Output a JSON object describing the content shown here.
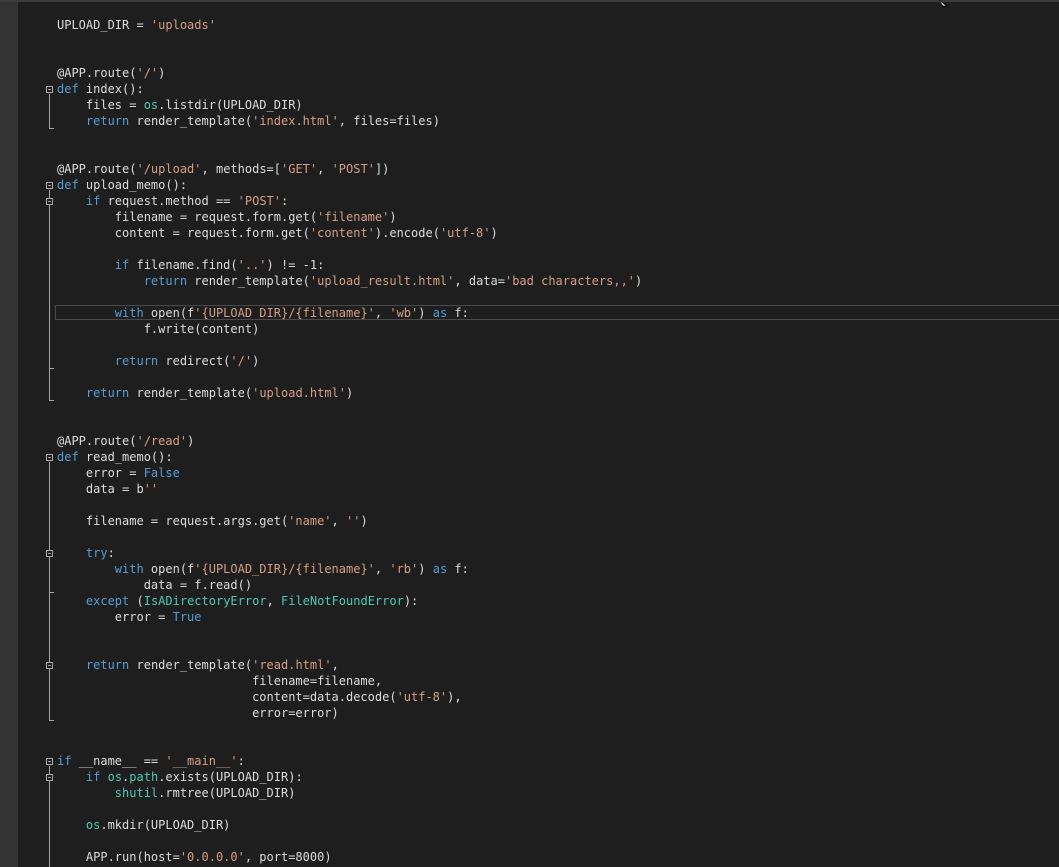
{
  "editor": {
    "lines": [
      [
        [
          "d",
          "UPLOAD_DIR = "
        ],
        [
          "s",
          "'uploads'"
        ]
      ],
      [],
      [],
      [
        [
          "d",
          "@APP.route("
        ],
        [
          "s",
          "'/'"
        ],
        [
          "d",
          ")"
        ]
      ],
      [
        [
          "k",
          "def"
        ],
        [
          "d",
          " index():"
        ]
      ],
      [
        [
          "d",
          "    files = "
        ],
        [
          "c",
          "os"
        ],
        [
          "d",
          ".listdir(UPLOAD_DIR)"
        ]
      ],
      [
        [
          "d",
          "    "
        ],
        [
          "k",
          "return"
        ],
        [
          "d",
          " render_template("
        ],
        [
          "s",
          "'index.html'"
        ],
        [
          "d",
          ", files=files)"
        ]
      ],
      [],
      [],
      [
        [
          "d",
          "@APP.route("
        ],
        [
          "s",
          "'/upload'"
        ],
        [
          "d",
          ", methods=["
        ],
        [
          "s",
          "'GET'"
        ],
        [
          "d",
          ", "
        ],
        [
          "s",
          "'POST'"
        ],
        [
          "d",
          "])"
        ]
      ],
      [
        [
          "k",
          "def"
        ],
        [
          "d",
          " upload_memo():"
        ]
      ],
      [
        [
          "d",
          "    "
        ],
        [
          "k",
          "if"
        ],
        [
          "d",
          " request.method == "
        ],
        [
          "s",
          "'POST'"
        ],
        [
          "d",
          ":"
        ]
      ],
      [
        [
          "d",
          "        filename = request.form.get("
        ],
        [
          "s",
          "'filename'"
        ],
        [
          "d",
          ")"
        ]
      ],
      [
        [
          "d",
          "        content = request.form.get("
        ],
        [
          "s",
          "'content'"
        ],
        [
          "d",
          ").encode("
        ],
        [
          "s",
          "'utf-8'"
        ],
        [
          "d",
          ")"
        ]
      ],
      [],
      [
        [
          "d",
          "        "
        ],
        [
          "k",
          "if"
        ],
        [
          "d",
          " filename.find("
        ],
        [
          "s",
          "'..'"
        ],
        [
          "d",
          ") != -1:"
        ]
      ],
      [
        [
          "d",
          "            "
        ],
        [
          "k",
          "return"
        ],
        [
          "d",
          " render_template("
        ],
        [
          "s",
          "'upload_result.html'"
        ],
        [
          "d",
          ", data="
        ],
        [
          "s",
          "'bad characters,,'"
        ],
        [
          "d",
          ")"
        ]
      ],
      [],
      [
        [
          "d",
          "        "
        ],
        [
          "k",
          "with"
        ],
        [
          "d",
          " open(f"
        ],
        [
          "s",
          "'{UPLOAD_DIR}/{filename}'"
        ],
        [
          "d",
          ", "
        ],
        [
          "s",
          "'wb'"
        ],
        [
          "d",
          ") "
        ],
        [
          "k",
          "as"
        ],
        [
          "d",
          " f:"
        ]
      ],
      [
        [
          "d",
          "            f.write(content)"
        ]
      ],
      [],
      [
        [
          "d",
          "        "
        ],
        [
          "k",
          "return"
        ],
        [
          "d",
          " redirect("
        ],
        [
          "s",
          "'/'"
        ],
        [
          "d",
          ")"
        ]
      ],
      [],
      [
        [
          "d",
          "    "
        ],
        [
          "k",
          "return"
        ],
        [
          "d",
          " render_template("
        ],
        [
          "s",
          "'upload.html'"
        ],
        [
          "d",
          ")"
        ]
      ],
      [],
      [],
      [
        [
          "d",
          "@APP.route("
        ],
        [
          "s",
          "'/read'"
        ],
        [
          "d",
          ")"
        ]
      ],
      [
        [
          "k",
          "def"
        ],
        [
          "d",
          " read_memo():"
        ]
      ],
      [
        [
          "d",
          "    error = "
        ],
        [
          "k",
          "False"
        ]
      ],
      [
        [
          "d",
          "    data = b"
        ],
        [
          "s",
          "''"
        ]
      ],
      [],
      [
        [
          "d",
          "    filename = request.args.get("
        ],
        [
          "s",
          "'name'"
        ],
        [
          "d",
          ", "
        ],
        [
          "s",
          "''"
        ],
        [
          "d",
          ")"
        ]
      ],
      [],
      [
        [
          "d",
          "    "
        ],
        [
          "k",
          "try"
        ],
        [
          "d",
          ":"
        ]
      ],
      [
        [
          "d",
          "        "
        ],
        [
          "k",
          "with"
        ],
        [
          "d",
          " open(f"
        ],
        [
          "s",
          "'{UPLOAD_DIR}/{filename}'"
        ],
        [
          "d",
          ", "
        ],
        [
          "s",
          "'rb'"
        ],
        [
          "d",
          ") "
        ],
        [
          "k",
          "as"
        ],
        [
          "d",
          " f:"
        ]
      ],
      [
        [
          "d",
          "            data = f.read()"
        ]
      ],
      [
        [
          "d",
          "    "
        ],
        [
          "k",
          "except"
        ],
        [
          "d",
          " ("
        ],
        [
          "c",
          "IsADirectoryError"
        ],
        [
          "d",
          ", "
        ],
        [
          "c",
          "FileNotFoundError"
        ],
        [
          "d",
          "):"
        ]
      ],
      [
        [
          "d",
          "        error = "
        ],
        [
          "k",
          "True"
        ]
      ],
      [],
      [],
      [
        [
          "d",
          "    "
        ],
        [
          "k",
          "return"
        ],
        [
          "d",
          " render_template("
        ],
        [
          "s",
          "'read.html'"
        ],
        [
          "d",
          ","
        ]
      ],
      [
        [
          "d",
          "                           filename=filename,"
        ]
      ],
      [
        [
          "d",
          "                           content=data.decode("
        ],
        [
          "s",
          "'utf-8'"
        ],
        [
          "d",
          "),"
        ]
      ],
      [
        [
          "d",
          "                           error=error)"
        ]
      ],
      [],
      [],
      [
        [
          "k",
          "if"
        ],
        [
          "d",
          " __name__ == "
        ],
        [
          "s",
          "'__main__'"
        ],
        [
          "d",
          ":"
        ]
      ],
      [
        [
          "d",
          "    "
        ],
        [
          "k",
          "if"
        ],
        [
          "d",
          " "
        ],
        [
          "c",
          "os"
        ],
        [
          "d",
          "."
        ],
        [
          "c",
          "path"
        ],
        [
          "d",
          ".exists(UPLOAD_DIR):"
        ]
      ],
      [
        [
          "d",
          "        "
        ],
        [
          "c",
          "shutil"
        ],
        [
          "d",
          ".rmtree(UPLOAD_DIR)"
        ]
      ],
      [],
      [
        [
          "d",
          "    "
        ],
        [
          "c",
          "os"
        ],
        [
          "d",
          ".mkdir(UPLOAD_DIR)"
        ]
      ],
      [],
      [
        [
          "d",
          "    APP.run(host="
        ],
        [
          "s",
          "'0.0.0.0'"
        ],
        [
          "d",
          ", port=8000)"
        ]
      ]
    ],
    "current_line": 18
  },
  "colors": {
    "background": "#1e1e1e",
    "keyword": "#569cd6",
    "string": "#d69d85",
    "class": "#4ec9b0",
    "default": "#dcdcdc"
  },
  "icons": [
    "fold-collapse-icon",
    "mouse-cursor-icon"
  ]
}
